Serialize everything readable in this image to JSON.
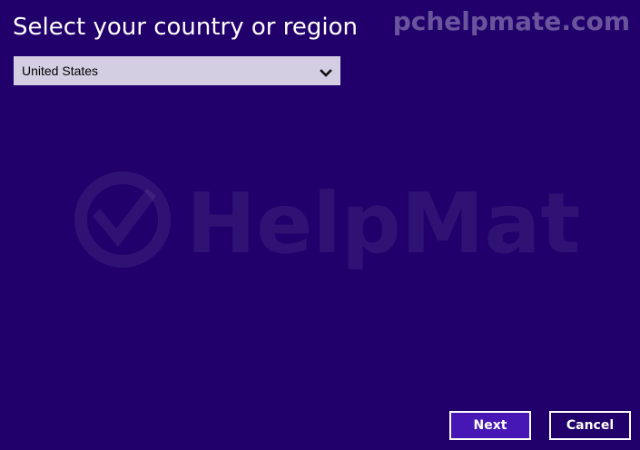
{
  "page": {
    "heading": "Select your country or region",
    "site_watermark": "pchelpmate.com",
    "logo_watermark_text": "HelpMate"
  },
  "country_select": {
    "value": "United States",
    "icon": "chevron-down-icon"
  },
  "buttons": {
    "next_label": "Next",
    "cancel_label": "Cancel"
  },
  "colors": {
    "background": "#21006b",
    "select_background": "#d4cee3",
    "next_background": "#4617b4",
    "text": "#ffffff"
  }
}
